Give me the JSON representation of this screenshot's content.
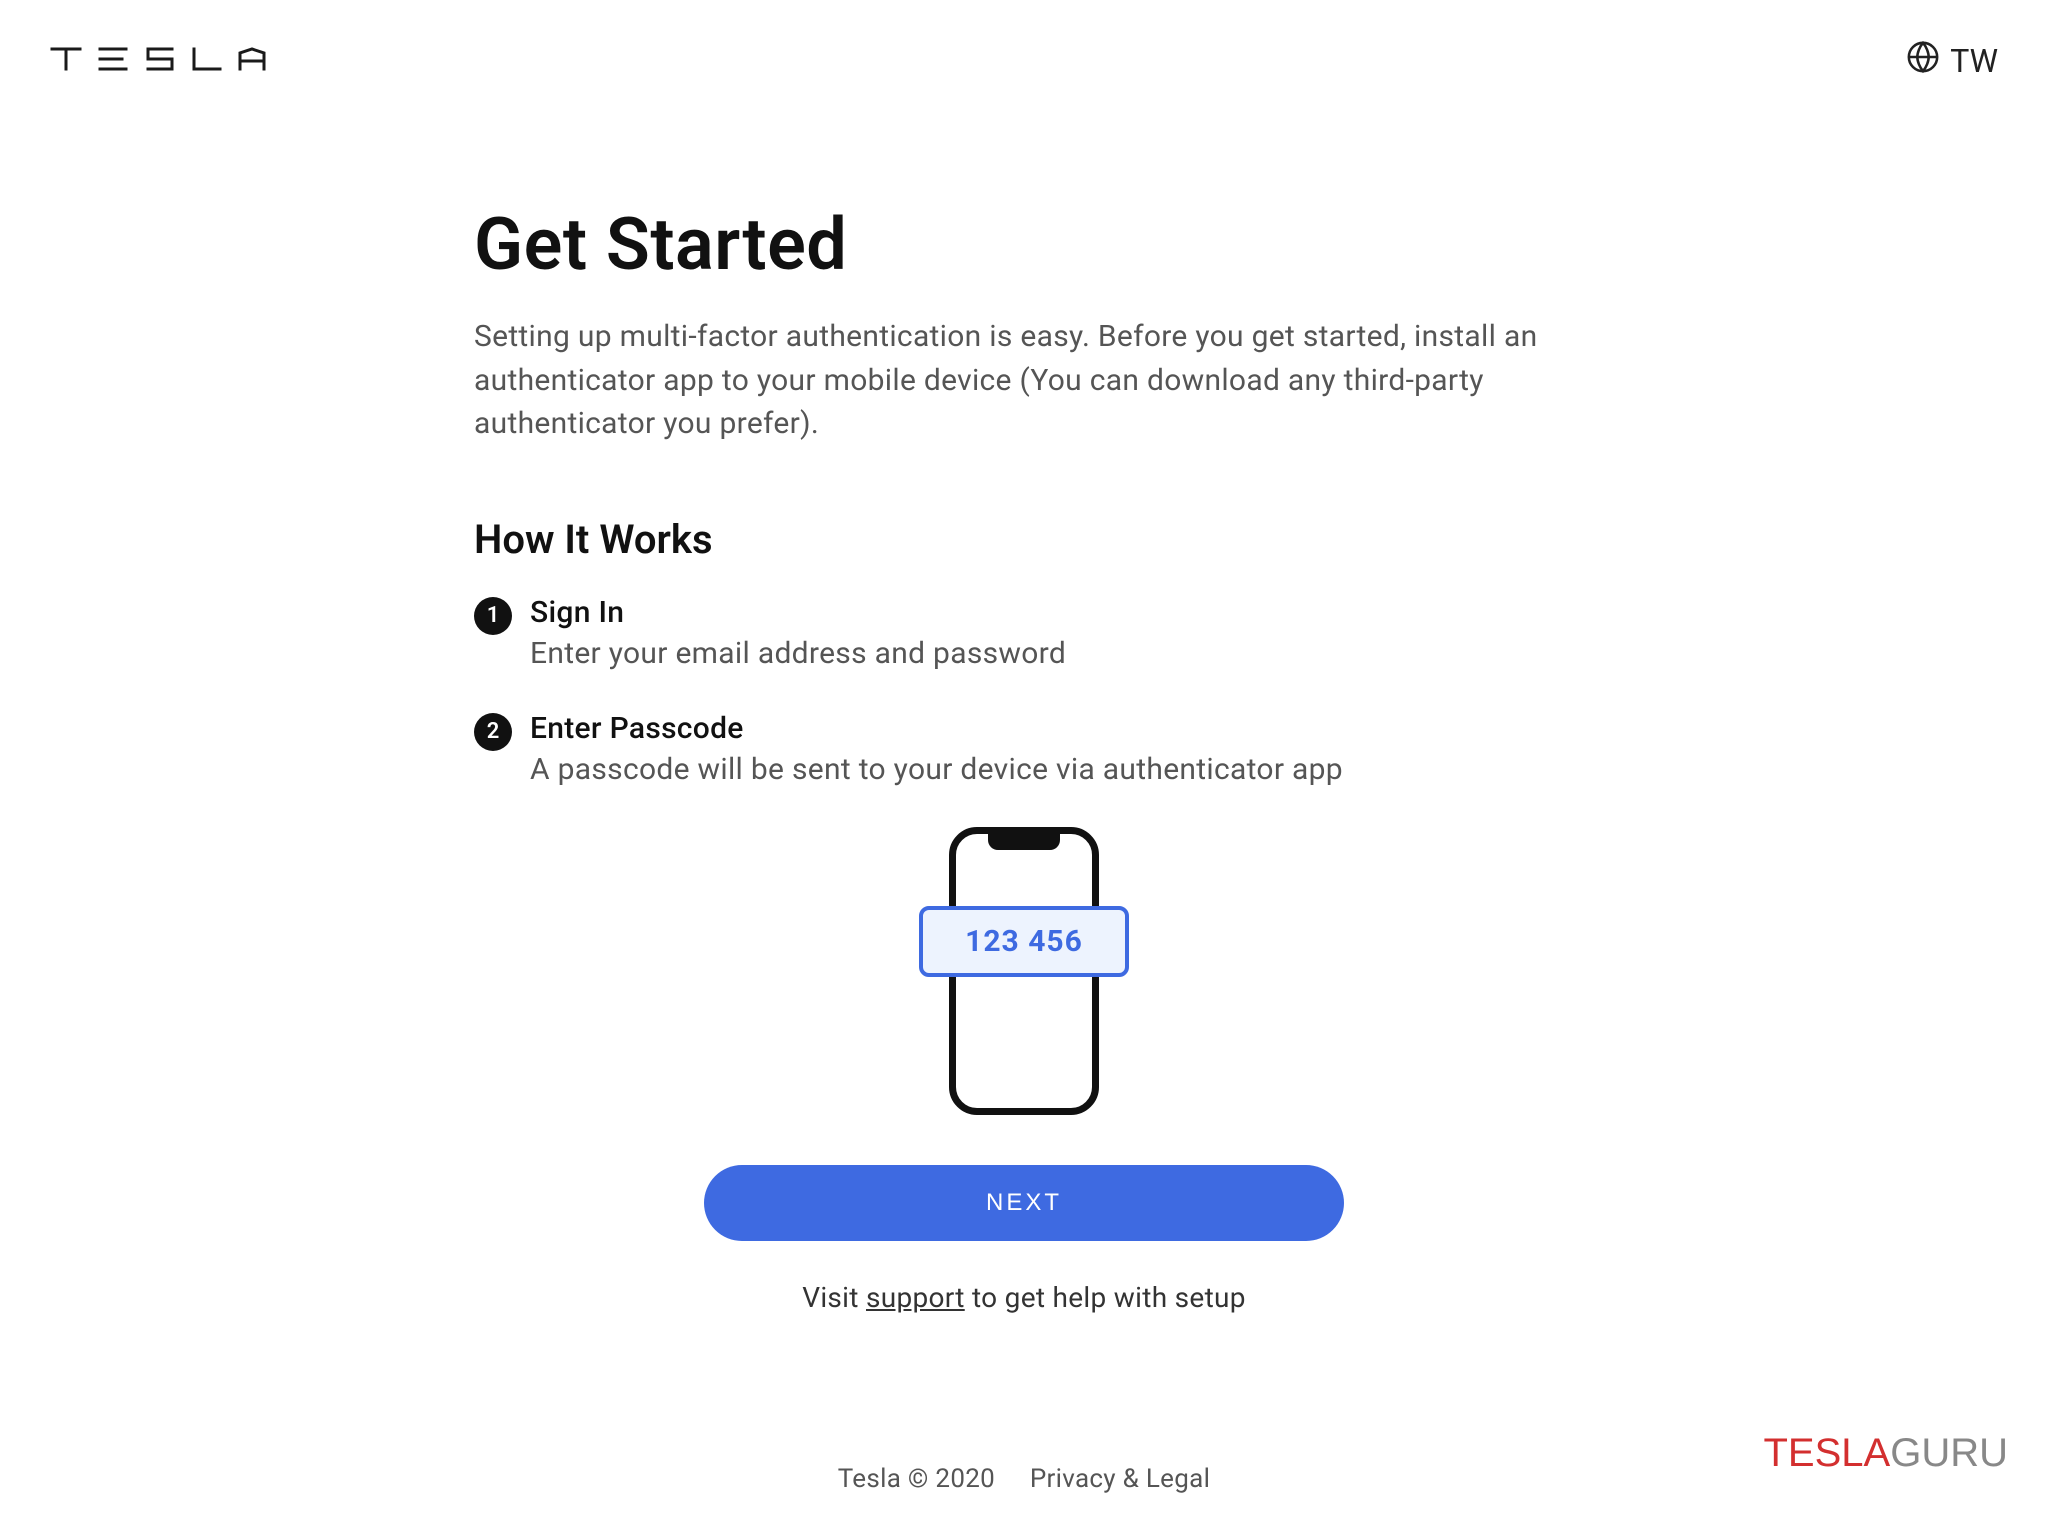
{
  "header": {
    "logo_text": "T E S L A",
    "locale_label": "TW"
  },
  "main": {
    "title": "Get Started",
    "intro": "Setting up multi-factor authentication is easy. Before you get started, install an authenticator app to your mobile device (You can download any third-party authenticator you prefer).",
    "how_it_works_title": "How It Works",
    "steps": [
      {
        "num": "1",
        "title": "Sign In",
        "desc": "Enter your email address and password"
      },
      {
        "num": "2",
        "title": "Enter Passcode",
        "desc": "A passcode will be sent to your device via authenticator app"
      }
    ],
    "sample_code": "123 456",
    "next_button": "NEXT",
    "support_prefix": "Visit ",
    "support_link": "support",
    "support_suffix": " to get help with setup"
  },
  "footer": {
    "copyright": "Tesla © 2020",
    "legal": "Privacy & Legal"
  },
  "watermark": {
    "brand": "TESLA",
    "suffix": "GURU"
  }
}
